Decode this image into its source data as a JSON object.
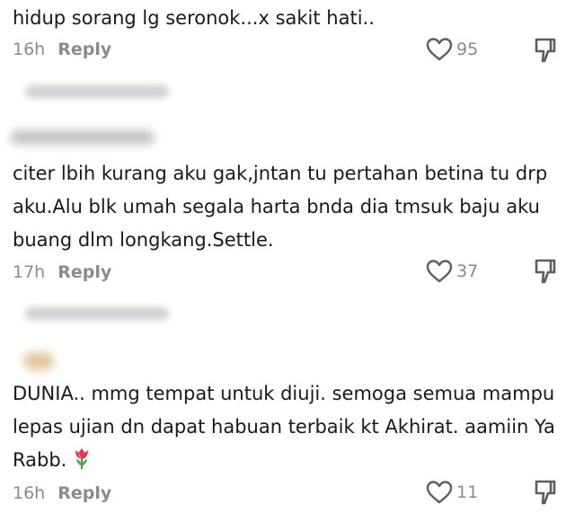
{
  "comments": [
    {
      "text": "hidup sorang lg seronok...x sakit hati..",
      "time": "16h",
      "reply_label": "Reply",
      "likes": "95"
    },
    {
      "text": "citer lbih kurang aku gak,jntan tu pertahan betina tu drp aku.Alu blk umah segala harta bnda dia tmsuk baju aku buang dlm longkang.Settle.",
      "time": "17h",
      "reply_label": "Reply",
      "likes": "37"
    },
    {
      "text": "DUNIA.. mmg tempat untuk diuji. semoga semua mampu lepas ujian dn dapat habuan terbaik kt Akhirat. aamiin Ya Rabb.",
      "emoji": "tulip-emoji",
      "time": "16h",
      "reply_label": "Reply",
      "likes": "11"
    }
  ],
  "icons": {
    "like": "heart-outline-icon",
    "dislike": "thumbs-down-outline-icon"
  },
  "colors": {
    "text": "#161823",
    "meta": "#8a8b91",
    "icon": "#5d5e63"
  }
}
